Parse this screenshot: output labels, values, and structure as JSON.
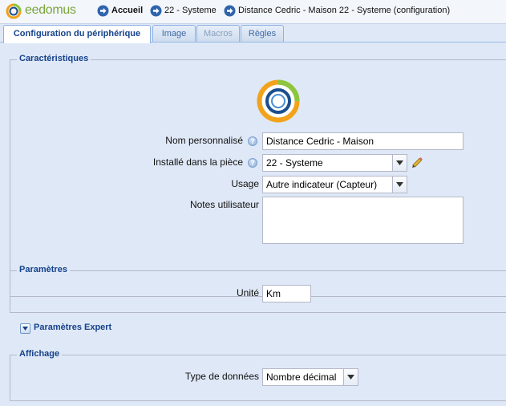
{
  "header": {
    "logo_text": "eedomus",
    "breadcrumbs": [
      {
        "label": "Accueil"
      },
      {
        "label": "22 - Systeme"
      },
      {
        "label": "Distance Cedric - Maison 22 - Systeme (configuration)"
      }
    ]
  },
  "tabs": [
    {
      "label": "Configuration du périphérique",
      "state": "active"
    },
    {
      "label": "Image",
      "state": "normal"
    },
    {
      "label": "Macros",
      "state": "disabled"
    },
    {
      "label": "Règles",
      "state": "normal"
    }
  ],
  "characteristics": {
    "legend": "Caractéristiques",
    "device_icon": "ring-gauge-icon",
    "name_label": "Nom personnalisé",
    "name_value": "Distance Cedric - Maison",
    "room_label": "Installé dans la pièce",
    "room_value": "22 - Systeme",
    "usage_label": "Usage",
    "usage_value": "Autre indicateur (Capteur)",
    "notes_label": "Notes utilisateur",
    "notes_value": ""
  },
  "parameters": {
    "legend": "Paramètres",
    "unit_label": "Unité",
    "unit_value": "Km"
  },
  "expert": {
    "legend": "Paramètres Expert"
  },
  "display": {
    "legend": "Affichage",
    "datatype_label": "Type de données",
    "datatype_value": "Nombre décimal"
  },
  "colors": {
    "accent": "#15428b",
    "panel_bg": "#dfe8f6",
    "logo_green": "#7aa43a",
    "logo_orange": "#f2a21b"
  }
}
